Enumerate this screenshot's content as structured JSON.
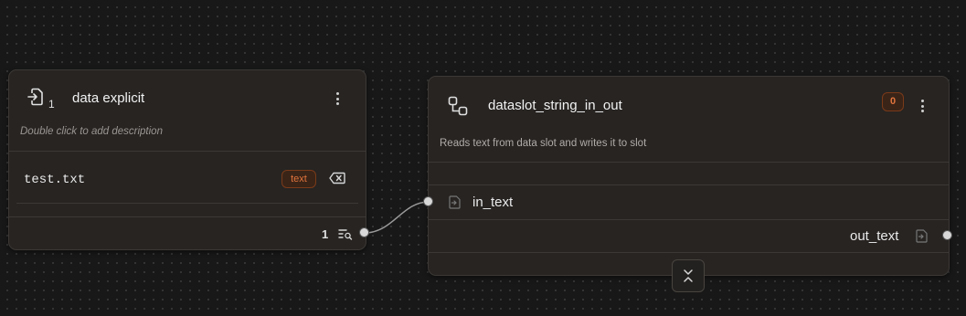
{
  "nodes": {
    "data_explicit": {
      "index": "1",
      "title": "data explicit",
      "description": "Double click to add description",
      "item_value": "test.txt",
      "type_badge": "text",
      "output_count": "1"
    },
    "dataslot": {
      "title": "dataslot_string_in_out",
      "description": "Reads text from data slot and writes it to slot",
      "counter_badge": "0",
      "input_label": "in_text",
      "output_label": "out_text"
    }
  },
  "colors": {
    "canvas": "#181818",
    "node_bg": "#272422",
    "badge_accent": "#e0743c"
  }
}
